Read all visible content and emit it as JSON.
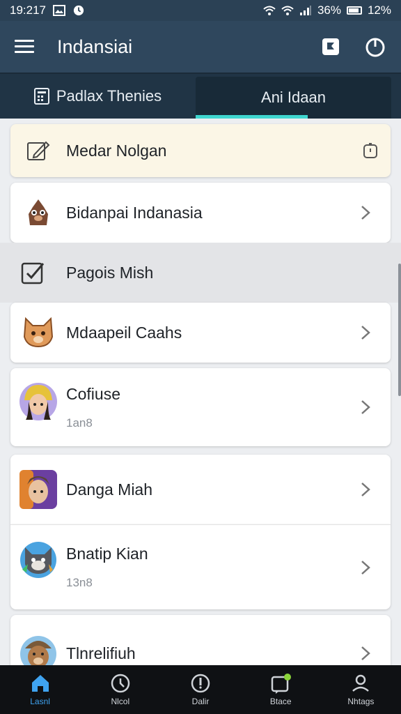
{
  "status_bar": {
    "time": "19:217",
    "battery_pct": "36%",
    "signal_pct": "12%"
  },
  "app_bar": {
    "title": "Indansiai"
  },
  "tabs": [
    {
      "label": "Padlax Thenies",
      "active": false
    },
    {
      "label": "Ani Idaan",
      "active": true
    }
  ],
  "list": [
    {
      "label": "Medar Nolgan",
      "sub": "",
      "leading_icon": "edit-icon",
      "trailing_icon": "timer-icon"
    },
    {
      "label": "Bidanpai Indanasia",
      "sub": "",
      "leading_icon": "mole-avatar",
      "trailing_icon": "chevron-right-icon"
    },
    {
      "label": "Pagois Mish",
      "sub": "",
      "leading_icon": "checkbox-icon",
      "trailing_icon": ""
    },
    {
      "label": "Mdaapeil Caahs",
      "sub": "",
      "leading_icon": "fox-avatar",
      "trailing_icon": "chevron-right-icon"
    },
    {
      "label": "Cofiuse",
      "sub": "1an8",
      "leading_icon": "girl-avatar",
      "trailing_icon": "chevron-right-icon"
    },
    {
      "label": "Danga Miah",
      "sub": "",
      "leading_icon": "hero-avatar",
      "trailing_icon": "chevron-right-icon"
    },
    {
      "label": "Bnatip Kian",
      "sub": "13n8",
      "leading_icon": "raccoon-avatar",
      "trailing_icon": "chevron-right-icon"
    },
    {
      "label": "Tlnrelifiuh",
      "sub": "",
      "leading_icon": "bear-avatar",
      "trailing_icon": "chevron-right-icon"
    }
  ],
  "bottom_nav": [
    {
      "label": "Lasnl",
      "icon": "home-icon",
      "active": true
    },
    {
      "label": "Nlcol",
      "icon": "clock-icon",
      "active": false
    },
    {
      "label": "Dalir",
      "icon": "compass-icon",
      "active": false
    },
    {
      "label": "Btace",
      "icon": "chat-icon",
      "active": false
    },
    {
      "label": "Nhtags",
      "icon": "person-icon",
      "active": false
    }
  ],
  "colors": {
    "accent": "#3fd6cf",
    "appbar": "#2f475d",
    "nav_active": "#3fa3f0"
  }
}
